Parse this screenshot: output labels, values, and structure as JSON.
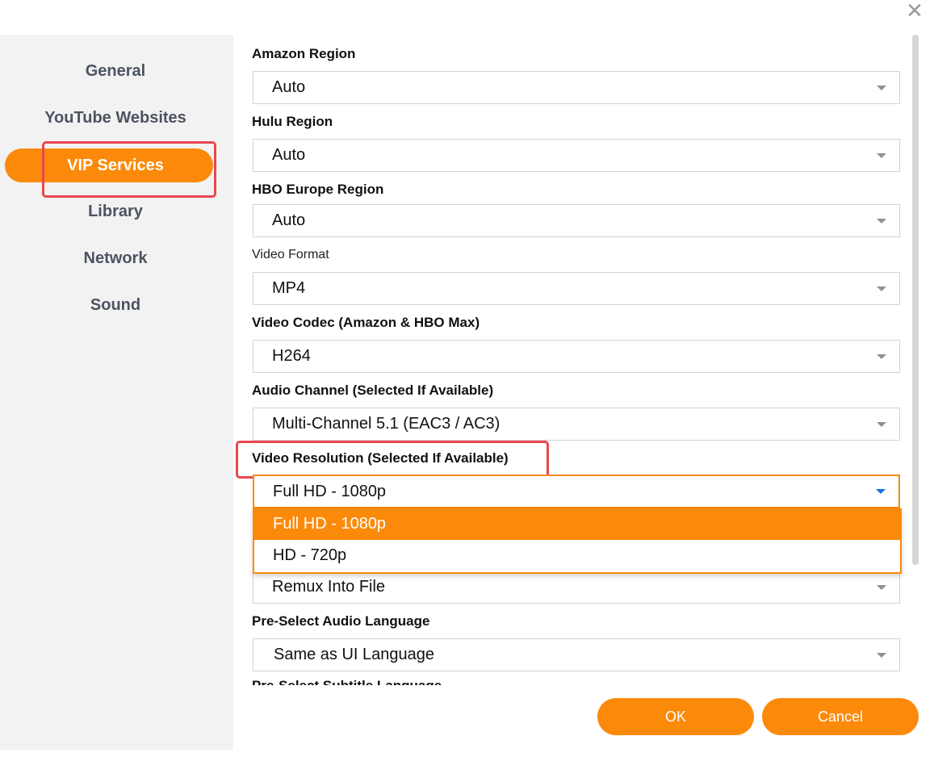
{
  "sidebar": {
    "items": [
      {
        "label": "General"
      },
      {
        "label": "YouTube Websites"
      },
      {
        "label": "VIP Services"
      },
      {
        "label": "Library"
      },
      {
        "label": "Network"
      },
      {
        "label": "Sound"
      }
    ]
  },
  "settings": {
    "amazon_region": {
      "label": "Amazon Region",
      "value": "Auto"
    },
    "hulu_region": {
      "label": "Hulu Region",
      "value": "Auto"
    },
    "hbo_europe_region": {
      "label": "HBO Europe Region",
      "value": "Auto"
    },
    "video_format": {
      "label": "Video Format",
      "value": "MP4"
    },
    "video_codec": {
      "label": "Video Codec (Amazon & HBO Max)",
      "value": "H264"
    },
    "audio_channel": {
      "label": "Audio Channel (Selected If Available)",
      "value": "Multi-Channel 5.1 (EAC3 / AC3)"
    },
    "video_resolution": {
      "label": "Video Resolution (Selected If Available)",
      "value": "Full HD - 1080p",
      "options": [
        "Full HD - 1080p",
        "HD - 720p"
      ]
    },
    "subtitle_mode": {
      "value": "Remux Into File"
    },
    "pre_select_audio_language": {
      "label": "Pre-Select Audio Language",
      "value": "Same as UI Language"
    },
    "pre_select_subtitle": {
      "label": "Pre-Select Subtitle Language"
    }
  },
  "buttons": {
    "ok": "OK",
    "cancel": "Cancel"
  },
  "icons": {
    "close": "close-icon",
    "dropdown": "chevron-down-icon"
  },
  "colors": {
    "accent": "#fb8a0b",
    "highlight": "#e9474f",
    "sidebar_bg": "#f2f2f2"
  }
}
